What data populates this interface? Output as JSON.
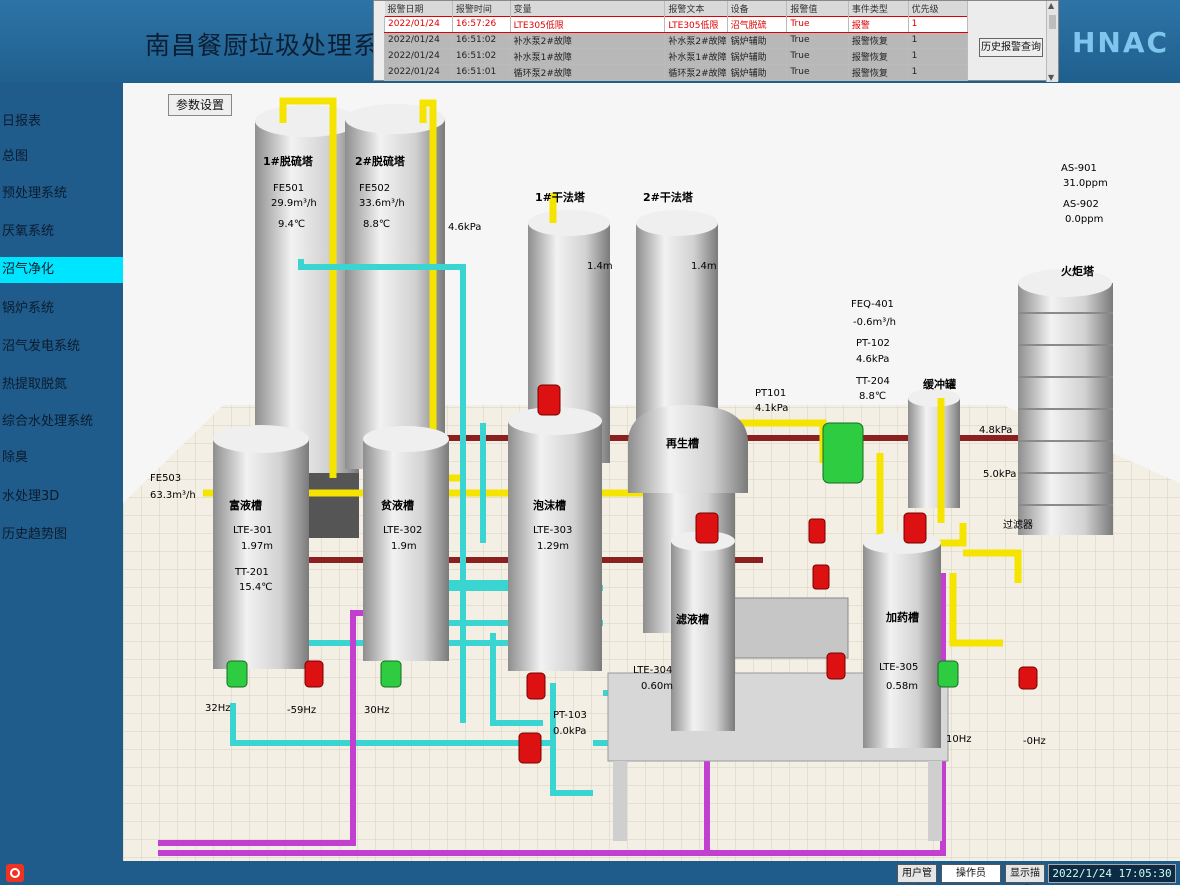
{
  "app": {
    "title": "南昌餐厨垃圾处理系统",
    "logo": "HNAC"
  },
  "alarms": {
    "headers": [
      "报警日期",
      "报警时间",
      "变量",
      "报警文本",
      "设备",
      "报警值",
      "事件类型",
      "优先级"
    ],
    "rows": [
      [
        "2022/01/24",
        "16:57:26",
        "LTE305低限",
        "LTE305低限",
        "沼气脱硫",
        "True",
        "报警",
        "1"
      ],
      [
        "2022/01/24",
        "16:51:02",
        "补水泵2#故障",
        "补水泵2#故障",
        "锅炉辅助",
        "True",
        "报警恢复",
        "1"
      ],
      [
        "2022/01/24",
        "16:51:02",
        "补水泵1#故障",
        "补水泵1#故障",
        "锅炉辅助",
        "True",
        "报警恢复",
        "1"
      ],
      [
        "2022/01/24",
        "16:51:01",
        "循环泵2#故障",
        "循环泵2#故障",
        "锅炉辅助",
        "True",
        "报警恢复",
        "1"
      ]
    ],
    "history_button": "历史报警查询"
  },
  "sidebar": {
    "items": [
      {
        "label": "日报表"
      },
      {
        "label": "总图"
      },
      {
        "label": "预处理系统"
      },
      {
        "label": "厌氧系统"
      },
      {
        "label": "沼气净化"
      },
      {
        "label": "锅炉系统"
      },
      {
        "label": "沼气发电系统"
      },
      {
        "label": "热提取脱氮"
      },
      {
        "label": "综合水处理系统"
      },
      {
        "label": "除臭"
      },
      {
        "label": "水处理3D"
      },
      {
        "label": "历史趋势图"
      }
    ],
    "active_index": 4
  },
  "main": {
    "param_button": "参数设置",
    "labels": {
      "t1_name": "1#脱硫塔",
      "t1_tag": "FE501",
      "t1_flow": "29.9m³/h",
      "t1_temp": "9.4℃",
      "t2_name": "2#脱硫塔",
      "t2_tag": "FE502",
      "t2_flow": "33.6m³/h",
      "t2_temp": "8.8℃",
      "t2_pressure": "4.6kPa",
      "dry1_name": "1#干法塔",
      "dry1_level": "1.4m",
      "dry2_name": "2#干法塔",
      "dry2_level": "1.4m",
      "as901_tag": "AS-901",
      "as901_val": "31.0ppm",
      "as902_tag": "AS-902",
      "as902_val": "0.0ppm",
      "flare_name": "火炬塔",
      "feq401_tag": "FEQ-401",
      "feq401_val": "-0.6m³/h",
      "pt102_tag": "PT-102",
      "pt102_val": "4.6kPa",
      "tt204_tag": "TT-204",
      "tt204_val": "8.8℃",
      "pt101_tag": "PT101",
      "pt101_val": "4.1kPa",
      "buffer_name": "缓冲罐",
      "p48": "4.8kPa",
      "p50": "5.0kPa",
      "filter_name": "过滤器",
      "fe503_tag": "FE503",
      "fe503_val": "63.3m³/h",
      "rich_name": "富液槽",
      "rich_tag": "LTE-301",
      "rich_level": "1.97m",
      "rich_tt": "TT-201",
      "rich_temp": "15.4℃",
      "lean_name": "贫液槽",
      "lean_tag": "LTE-302",
      "lean_level": "1.9m",
      "foam_name": "泡沫槽",
      "foam_tag": "LTE-303",
      "foam_level": "1.29m",
      "regen_name": "再生槽",
      "filtrate_name": "滤液槽",
      "filtrate_tag": "LTE-304",
      "filtrate_level": "0.60m",
      "dosing_name": "加药槽",
      "dosing_tag": "LTE-305",
      "dosing_level": "0.58m",
      "pt103_tag": "PT-103",
      "pt103_val": "0.0kPa",
      "hz1": "32Hz",
      "hz2": "-59Hz",
      "hz3": "30Hz",
      "hz4": "10Hz",
      "hz5": "-0Hz"
    }
  },
  "status": {
    "user_mgmt": "用户管理",
    "operator": "操作员",
    "display_desc": "显示描述",
    "datetime": "2022/1/24  17:05:30"
  },
  "colors": {
    "active_nav": "#00e5ff",
    "alarm_text": "#e10000",
    "pipe_yellow": "#f5e400",
    "pipe_cyan": "#3ad5d0",
    "pipe_magenta": "#c23fd0",
    "pipe_red": "#8a2020"
  }
}
